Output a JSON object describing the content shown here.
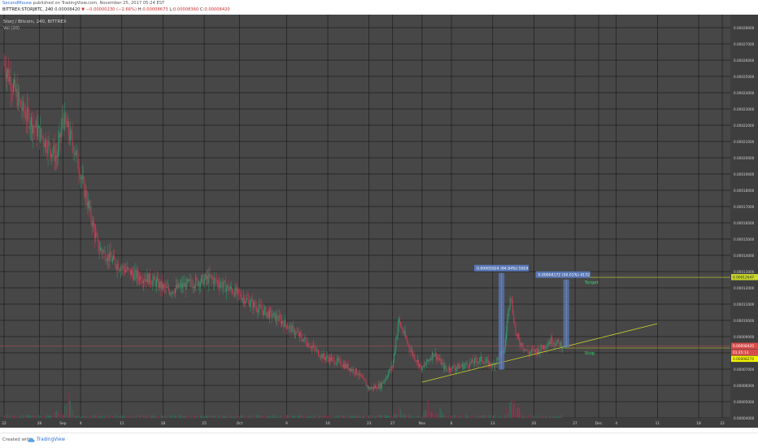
{
  "header": {
    "author": "SecondMouse",
    "published": "published on TradingView.com, November 25, 2017 05:24 EST",
    "symbol": "BITTREX:STORJBTC, 240",
    "price": "0.00008420",
    "change": "−0.00000230 (−2.66%)",
    "ohlc": [
      {
        "label": "H:",
        "value": "0.00008673"
      },
      {
        "label": "L:",
        "value": "0.00008360"
      },
      {
        "label": "C:",
        "value": "0.00008420"
      }
    ]
  },
  "pane": {
    "title": "Storj / Bitcoin, 240, BITTREX",
    "volume_label": "Vol (20)"
  },
  "footer": {
    "created_with": "Created with",
    "brand": "TradingView"
  },
  "colors": {
    "background": "#474747",
    "grid": "#1e1e1e",
    "up": "#2d9e6f",
    "down": "#c93a55",
    "trendline": "#c9d62b",
    "target": "#c9d62b",
    "stop": "#c9d62b",
    "annotation": "#5a78b6",
    "last_price": "#e05050"
  },
  "chart_data": {
    "type": "candlestick",
    "title": "Storj / Bitcoin, 240, BITTREX",
    "x_tick_labels": [
      "22",
      "28",
      "Sep",
      "4",
      "11",
      "18",
      "25",
      "Oct",
      "9",
      "16",
      "23",
      "27",
      "Nov",
      "6",
      "13",
      "20",
      "27",
      "Dec",
      "4",
      "11",
      "18",
      "22"
    ],
    "y_tick_labels": [
      "0.00004000",
      "0.00005000",
      "0.00006000",
      "0.00007000",
      "0.00008000",
      "0.00009000",
      "0.00010000",
      "0.00011000",
      "0.00012000",
      "0.00013000",
      "0.00014000",
      "0.00015000",
      "0.00016000",
      "0.00017000",
      "0.00018000",
      "0.00019000",
      "0.00020000",
      "0.00021000",
      "0.00022000",
      "0.00023000",
      "0.00024000",
      "0.00025000",
      "0.00026000",
      "0.00027000",
      "0.00028000"
    ],
    "ylim": [
      4e-05,
      0.000284
    ],
    "log_scale": false,
    "grid": true,
    "price_series": [
      {
        "date": "2017-08-22",
        "close": 0.000258
      },
      {
        "date": "2017-08-25",
        "close": 0.00023
      },
      {
        "date": "2017-08-28",
        "close": 0.000215
      },
      {
        "date": "2017-08-31",
        "close": 0.0002
      },
      {
        "date": "2017-09-01",
        "close": 0.000225
      },
      {
        "date": "2017-09-03",
        "close": 0.000205
      },
      {
        "date": "2017-09-05",
        "close": 0.000175
      },
      {
        "date": "2017-09-07",
        "close": 0.000145
      },
      {
        "date": "2017-09-10",
        "close": 0.000135
      },
      {
        "date": "2017-09-13",
        "close": 0.000128
      },
      {
        "date": "2017-09-16",
        "close": 0.000125
      },
      {
        "date": "2017-09-19",
        "close": 0.000118
      },
      {
        "date": "2017-09-22",
        "close": 0.000122
      },
      {
        "date": "2017-09-26",
        "close": 0.000126
      },
      {
        "date": "2017-09-30",
        "close": 0.000118
      },
      {
        "date": "2017-10-04",
        "close": 0.000108
      },
      {
        "date": "2017-10-08",
        "close": 0.0001
      },
      {
        "date": "2017-10-12",
        "close": 8.8e-05
      },
      {
        "date": "2017-10-15",
        "close": 7.8e-05
      },
      {
        "date": "2017-10-18",
        "close": 7.4e-05
      },
      {
        "date": "2017-10-21",
        "close": 6.8e-05
      },
      {
        "date": "2017-10-23",
        "close": 5.8e-05
      },
      {
        "date": "2017-10-25",
        "close": 6e-05
      },
      {
        "date": "2017-10-27",
        "close": 7.2e-05
      },
      {
        "date": "2017-10-28",
        "close": 0.0001
      },
      {
        "date": "2017-10-30",
        "close": 8.2e-05
      },
      {
        "date": "2017-11-01",
        "close": 7e-05
      },
      {
        "date": "2017-11-03",
        "close": 8e-05
      },
      {
        "date": "2017-11-05",
        "close": 7e-05
      },
      {
        "date": "2017-11-08",
        "close": 7.2e-05
      },
      {
        "date": "2017-11-11",
        "close": 7.6e-05
      },
      {
        "date": "2017-11-13",
        "close": 7.2e-05
      },
      {
        "date": "2017-11-15",
        "close": 8.2e-05
      },
      {
        "date": "2017-11-16",
        "close": 0.000118
      },
      {
        "date": "2017-11-17",
        "close": 9e-05
      },
      {
        "date": "2017-11-19",
        "close": 8e-05
      },
      {
        "date": "2017-11-21",
        "close": 8.2e-05
      },
      {
        "date": "2017-11-23",
        "close": 8.8e-05
      },
      {
        "date": "2017-11-25",
        "close": 8.42e-05
      }
    ],
    "trendline": {
      "from": {
        "date": "2017-11-01",
        "price": 6.2e-05
      },
      "to": {
        "date": "2017-12-11",
        "price": 9.8e-05
      }
    },
    "levels": [
      {
        "name": "Target",
        "label": "Target",
        "price": 0.00012647,
        "price_label": "0.00012647"
      },
      {
        "name": "Stop",
        "label": "Stop",
        "price": 8.3e-05,
        "price_label": "0.00008274"
      }
    ],
    "price_labels": [
      {
        "price": 8.42e-05,
        "text": "0.00008420"
      },
      {
        "price": 8.36e-05,
        "text": "01:35:13"
      }
    ],
    "measurements": [
      {
        "label": "0.00005924 (84.84%) 5924",
        "start_date": "2017-11-14",
        "end_date": "2017-11-15",
        "from": 6.98e-05,
        "to": 0.0001291
      },
      {
        "label": "0.00004172 (50.01%) 4172",
        "start_date": "2017-11-25",
        "end_date": "2017-11-26",
        "from": 8.34e-05,
        "to": 0.0001251
      }
    ],
    "volume": [
      {
        "date": "2017-08-31",
        "value": 0.3
      },
      {
        "date": "2017-09-02",
        "value": 1.0
      },
      {
        "date": "2017-10-28",
        "value": 0.55
      },
      {
        "date": "2017-11-02",
        "value": 0.8
      },
      {
        "date": "2017-11-04",
        "value": 0.45
      },
      {
        "date": "2017-11-16",
        "value": 0.9
      },
      {
        "date": "2017-11-17",
        "value": 0.7
      }
    ]
  }
}
